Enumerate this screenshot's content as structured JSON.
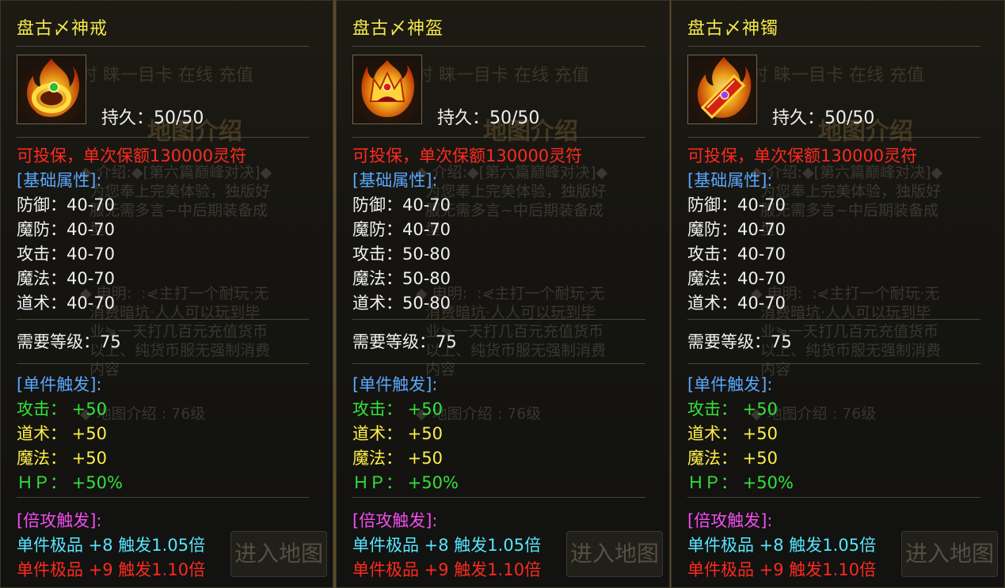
{
  "panels": [
    {
      "name": "盘古〆神戒",
      "durability": "持久：50/50",
      "insurance": "可投保，单次保额130000灵符",
      "base_header": "[基础属性]:",
      "base_stats": [
        "防御：40-70",
        "魔防：40-70",
        "攻击：40-70",
        "魔法：40-70",
        "道术：40-70"
      ],
      "level_req": "需要等级：75",
      "set_header": "[单件触发]:",
      "set_attack": "攻击： +50",
      "set_tao": "道术： +50",
      "set_magic": "魔法： +50",
      "set_hp": "ＨＰ： +50%",
      "mult_header": "[倍攻触发]:",
      "mult_line1": "单件极品 +8 触发1.05倍",
      "mult_line2": "单件极品 +9 触发1.10倍",
      "icon": "flaming-ring-icon"
    },
    {
      "name": "盘古〆神盔",
      "durability": "持久：50/50",
      "insurance": "可投保，单次保额130000灵符",
      "base_header": "[基础属性]:",
      "base_stats": [
        "防御：40-70",
        "魔防：40-70",
        "攻击：50-80",
        "魔法：50-80",
        "道术：50-80"
      ],
      "level_req": "需要等级：75",
      "set_header": "[单件触发]:",
      "set_attack": "攻击： +50",
      "set_tao": "道术： +50",
      "set_magic": "魔法： +50",
      "set_hp": "ＨＰ： +50%",
      "mult_header": "[倍攻触发]:",
      "mult_line1": "单件极品 +8 触发1.05倍",
      "mult_line2": "单件极品 +9 触发1.10倍",
      "icon": "flaming-helmet-icon"
    },
    {
      "name": "盘古〆神镯",
      "durability": "持久：50/50",
      "insurance": "可投保，单次保额130000灵符",
      "base_header": "[基础属性]:",
      "base_stats": [
        "防御：40-70",
        "魔防：40-70",
        "攻击：40-70",
        "魔法：40-70",
        "道术：40-70"
      ],
      "level_req": "需要等级：75",
      "set_header": "[单件触发]:",
      "set_attack": "攻击： +50",
      "set_tao": "道术： +50",
      "set_magic": "魔法： +50",
      "set_hp": "ＨＰ： +50%",
      "mult_header": "[倍攻触发]:",
      "mult_line1": "单件极品 +8 触发1.05倍",
      "mult_line2": "单件极品 +9 触发1.10倍",
      "icon": "flaming-bracelet-icon"
    }
  ],
  "background": {
    "top_line": "时 睐一目卡 在线 充值",
    "map_title": "地图介绍",
    "intro": "◆ 介绍:◆[第六篇巅峰对决]◆\n  为您奉上完美体验，独版好\n  服无需多言~中后期装备成\n  型",
    "decl": "◆ 申明:  :⋞主打一个耐玩·无\n  消费暗坑·人人可以玩到毕\n  业⋟一天打几百元充值货币\n  以上、纯货币服无强制消费\n  内容",
    "map": "◆ 地图介绍 : 76级",
    "enter_button": "进入地图"
  },
  "colors": {
    "title": "#f5e94a",
    "insurance": "#ff2a1e",
    "header_blue": "#5aa8ff",
    "set_green": "#33e23a",
    "set_yellow": "#ffef4a",
    "mult_header": "#f24cf0",
    "mult_cyan": "#56e6ff",
    "mult_red": "#ff2a1e"
  }
}
